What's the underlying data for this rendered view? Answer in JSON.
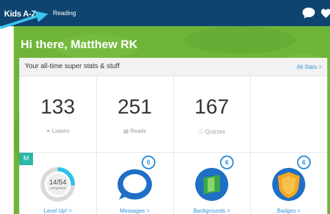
{
  "header": {
    "logo": "Kids A-Z",
    "nav_item": "Reading"
  },
  "greeting": "Hi there, Matthew RK",
  "stats_card": {
    "title": "Your all-time super stats & stuff",
    "all_stats_link": "All Stats >",
    "stats": [
      {
        "value": "133",
        "label": "Listens",
        "icon": "headphones-icon"
      },
      {
        "value": "251",
        "label": "Reads",
        "icon": "book-icon"
      },
      {
        "value": "167",
        "label": "Quizzes",
        "icon": "question-icon"
      }
    ],
    "badge": "M",
    "tiles": [
      {
        "label": "Level Up! >",
        "progress_text": "14/54",
        "progress_sub": "completed",
        "progress_fraction": 0.26
      },
      {
        "label": "Messages >",
        "count": "0"
      },
      {
        "label": "Backgrounds >",
        "count": "6"
      },
      {
        "label": "Badges >",
        "count": "6"
      }
    ]
  },
  "colors": {
    "topbar": "#0f4470",
    "hero_green": "#6fb53a",
    "accent_blue": "#2d8fd8",
    "teal": "#2ab7a9"
  }
}
